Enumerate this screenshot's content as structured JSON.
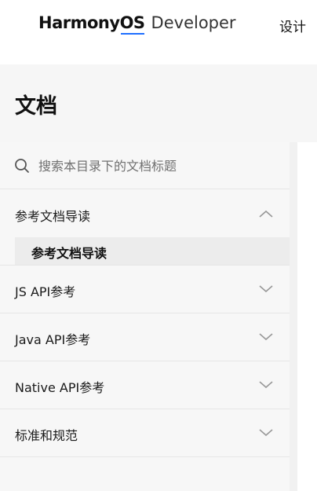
{
  "header": {
    "brand_name_part1": "Harmony",
    "brand_name_part2": "OS",
    "brand_sub": "Developer",
    "nav_item": "设计"
  },
  "page": {
    "title": "文档"
  },
  "search": {
    "placeholder": "搜索本目录下的文档标题"
  },
  "nav": {
    "sections": [
      {
        "label": "参考文档导读",
        "expanded": true,
        "children": [
          "参考文档导读"
        ]
      },
      {
        "label": "JS API参考",
        "expanded": false
      },
      {
        "label": "Java API参考",
        "expanded": false
      },
      {
        "label": "Native API参考",
        "expanded": false
      },
      {
        "label": "标准和规范",
        "expanded": false
      }
    ]
  },
  "colors": {
    "accent": "#1f6fff",
    "sidebar_bg": "#f7f7f7",
    "active_item_bg": "#ececec"
  }
}
